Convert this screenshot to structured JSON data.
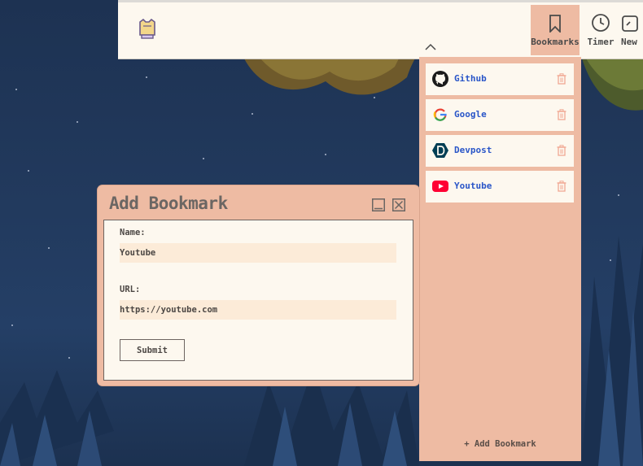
{
  "nav": {
    "items": [
      {
        "label": "Bookmarks",
        "icon": "bookmark-icon",
        "active": true
      },
      {
        "label": "Timer",
        "icon": "clock-icon"
      },
      {
        "label": "New",
        "icon": "new-tab-icon"
      }
    ]
  },
  "bookmarks": {
    "items": [
      {
        "label": "Github",
        "icon": "github-icon"
      },
      {
        "label": "Google",
        "icon": "google-icon"
      },
      {
        "label": "Devpost",
        "icon": "devpost-icon"
      },
      {
        "label": "Youtube",
        "icon": "youtube-icon"
      }
    ],
    "add_label": "+ Add Bookmark"
  },
  "dialog": {
    "title": "Add Bookmark",
    "name_label": "Name:",
    "name_value": "Youtube",
    "url_label": "URL:",
    "url_value": "https://youtube.com",
    "submit_label": "Submit"
  },
  "colors": {
    "panel": "#eebba3",
    "surface": "#fdf8ef",
    "input": "#fcebd8",
    "link": "#2a56c8"
  }
}
